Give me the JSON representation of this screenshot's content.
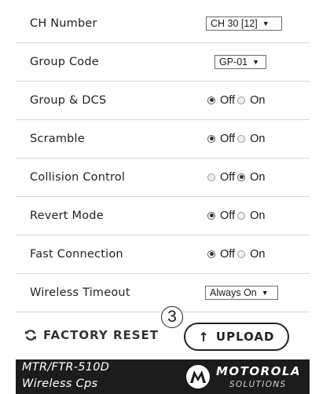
{
  "settings": {
    "ch_number": {
      "label": "CH Number",
      "value": "CH 30 [12]"
    },
    "group_code": {
      "label": "Group Code",
      "value": "GP-01"
    },
    "group_dcs": {
      "label": "Group & DCS",
      "off_label": "Off",
      "on_label": "On",
      "selected": "Off"
    },
    "scramble": {
      "label": "Scramble",
      "off_label": "Off",
      "on_label": "On",
      "selected": "Off"
    },
    "collision_control": {
      "label": "Collision Control",
      "off_label": "Off",
      "on_label": "On",
      "selected": "On"
    },
    "revert_mode": {
      "label": "Revert Mode",
      "off_label": "Off",
      "on_label": "On",
      "selected": "Off"
    },
    "fast_connection": {
      "label": "Fast Connection",
      "off_label": "Off",
      "on_label": "On",
      "selected": "Off"
    },
    "wireless_timeout": {
      "label": "Wireless Timeout",
      "value": "Always On"
    }
  },
  "actions": {
    "factory_reset_label": "FACTORY RESET",
    "upload_label": "UPLOAD",
    "step_marker": "3"
  },
  "footer": {
    "model": "MTR/FTR-510D",
    "product": "Wireless Cps",
    "brand": "MOTOROLA",
    "brand_sub": "SOLUTIONS"
  },
  "icons": {
    "factory_reset": "refresh-icon",
    "upload": "up-arrow-icon",
    "dropdown": "triangle-down-icon",
    "logo": "motorola-batwing-logo"
  }
}
